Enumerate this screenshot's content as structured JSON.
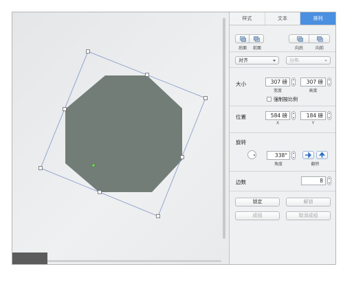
{
  "tabs": [
    {
      "label": "样式",
      "active": false
    },
    {
      "label": "文本",
      "active": false
    },
    {
      "label": "排列",
      "active": true
    }
  ],
  "arrange": {
    "back_label": "后面",
    "front_label": "前面",
    "forward_label": "向后",
    "backward_label": "向前"
  },
  "align": {
    "select_value": "对齐",
    "distribute_value": "分布"
  },
  "size": {
    "title": "大小",
    "width_value": "307 磅",
    "height_value": "307 磅",
    "width_label": "宽度",
    "height_label": "高度",
    "constrain_label": "强制按比例"
  },
  "position": {
    "title": "位置",
    "x_value": "584 磅",
    "y_value": "184 磅",
    "x_label": "X",
    "y_label": "Y"
  },
  "rotate": {
    "title": "旋转",
    "angle_value": "338°",
    "angle_label": "角度",
    "flip_label": "翻转"
  },
  "sides": {
    "title": "边数",
    "value": "8"
  },
  "actions": {
    "lock_label": "锁定",
    "unlock_label": "解锁",
    "group_label": "成组",
    "ungroup_label": "取消成组"
  },
  "colors": {
    "shape_fill": "#737d78",
    "selection_line": "#7f93c7",
    "active_tab": "#4a8fe0"
  },
  "shape": {
    "kind": "octagon",
    "rotation_deg": 338
  }
}
